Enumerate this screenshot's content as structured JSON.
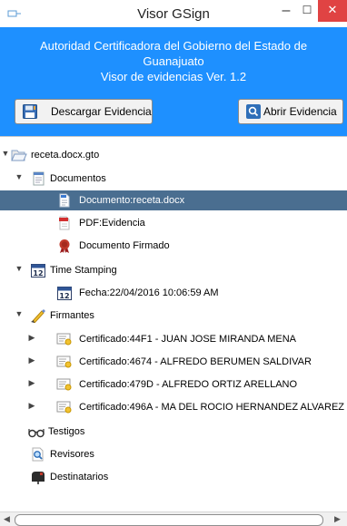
{
  "window": {
    "title": "Visor GSign",
    "app_icon": "app-icon",
    "min_glyph": "–",
    "max_glyph": "☐",
    "close_glyph": "✕",
    "close_color": "#e04343"
  },
  "header": {
    "line1": "Autoridad Certificadora del Gobierno del Estado de",
    "line2": "Guanajuato",
    "line3": "Visor de evidencias Ver. 1.2",
    "bg_color": "#1e90ff"
  },
  "toolbar": {
    "download_label": "Descargar Evidencia",
    "open_label": "Abrir Evidencia"
  },
  "tree": {
    "root": "receta.docx.gto",
    "documentos": "Documentos",
    "documento": "Documento:receta.docx",
    "pdf": "PDF:Evidencia",
    "firmado": "Documento Firmado",
    "time_stamping": "Time Stamping",
    "fecha": "Fecha:22/04/2016 10:06:59 AM",
    "firmantes": "Firmantes",
    "certificados": [
      "Certificado:44F1 - JUAN JOSE MIRANDA MENA",
      "Certificado:4674 - ALFREDO BERUMEN SALDIVAR",
      "Certificado:479D - ALFREDO ORTIZ ARELLANO",
      "Certificado:496A - MA DEL ROCIO HERNANDEZ ALVAREZ"
    ],
    "testigos": "Testigos",
    "revisores": "Revisores",
    "destinatarios": "Destinatarios",
    "selected_color": "#4a6e90"
  }
}
